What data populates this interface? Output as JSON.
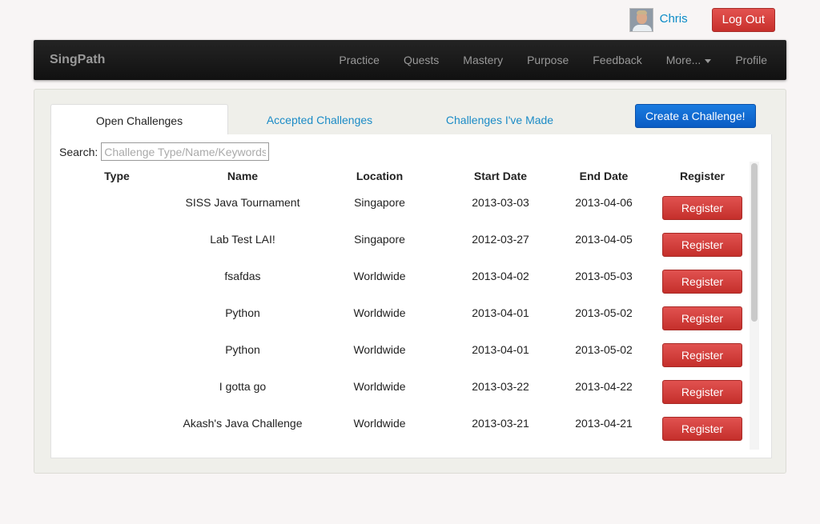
{
  "user": {
    "name": "Chris",
    "logout_label": "Log Out"
  },
  "navbar": {
    "brand": "SingPath",
    "items": [
      "Practice",
      "Quests",
      "Mastery",
      "Purpose",
      "Feedback",
      "More...",
      "Profile"
    ]
  },
  "tabs": [
    {
      "label": "Open Challenges",
      "active": true
    },
    {
      "label": "Accepted Challenges",
      "active": false
    },
    {
      "label": "Challenges I've Made",
      "active": false
    }
  ],
  "create_button": "Create a Challenge!",
  "search": {
    "label": "Search:",
    "placeholder": "Challenge Type/Name/Keywords"
  },
  "table": {
    "headers": [
      "Type",
      "Name",
      "Location",
      "Start Date",
      "End Date",
      "Register"
    ],
    "button_label": "Register",
    "rows": [
      {
        "type": "",
        "name": "SISS Java Tournament",
        "location": "Singapore",
        "start": "2013-03-03",
        "end": "2013-04-06"
      },
      {
        "type": "",
        "name": "Lab Test LAI!",
        "location": "Singapore",
        "start": "2012-03-27",
        "end": "2013-04-05"
      },
      {
        "type": "",
        "name": "fsafdas",
        "location": "Worldwide",
        "start": "2013-04-02",
        "end": "2013-05-03"
      },
      {
        "type": "",
        "name": "Python",
        "location": "Worldwide",
        "start": "2013-04-01",
        "end": "2013-05-02"
      },
      {
        "type": "",
        "name": "Python",
        "location": "Worldwide",
        "start": "2013-04-01",
        "end": "2013-05-02"
      },
      {
        "type": "",
        "name": "I gotta go",
        "location": "Worldwide",
        "start": "2013-03-22",
        "end": "2013-04-22"
      },
      {
        "type": "",
        "name": "Akash's Java Challenge",
        "location": "Worldwide",
        "start": "2013-03-21",
        "end": "2013-04-21"
      }
    ]
  },
  "colors": {
    "accent": "#0a5cc4",
    "danger": "#c8302c",
    "link": "#1b8bc6",
    "navbar": "#1a1a1a"
  }
}
